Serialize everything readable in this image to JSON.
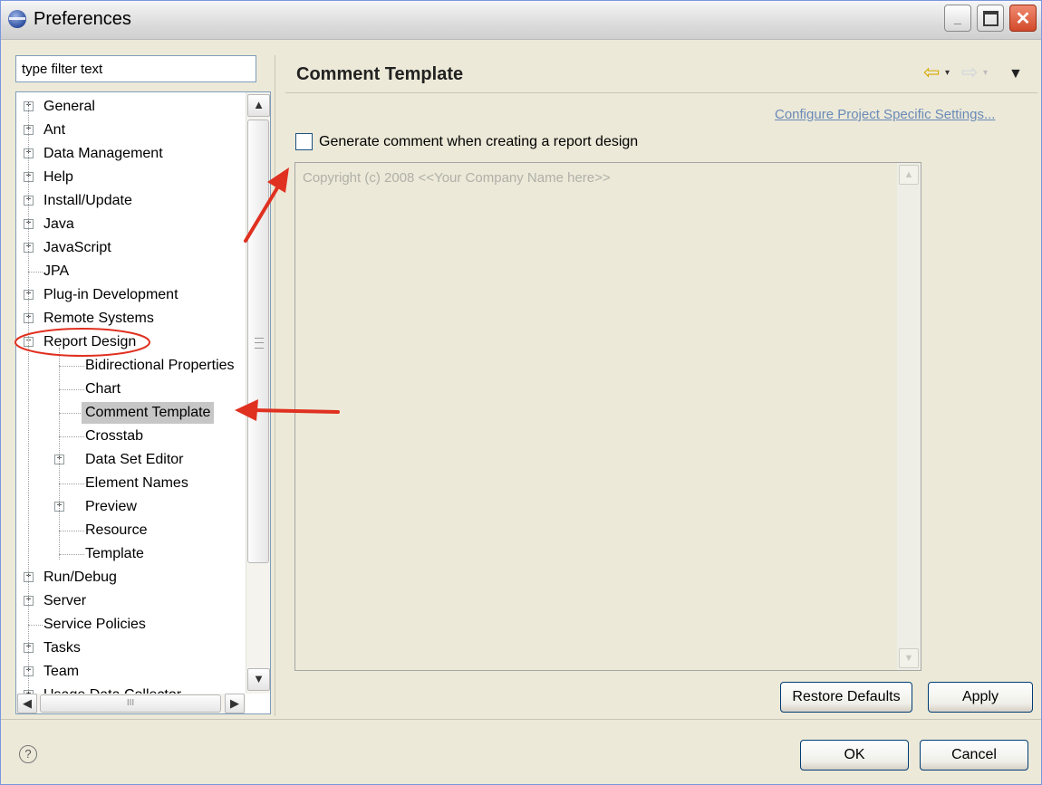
{
  "window": {
    "title": "Preferences",
    "controls": {
      "minimize": "_",
      "close": "✕"
    }
  },
  "filter": {
    "value": "type filter text"
  },
  "tree": {
    "items": [
      {
        "label": "General",
        "level": 0,
        "expander": "+"
      },
      {
        "label": "Ant",
        "level": 0,
        "expander": "+"
      },
      {
        "label": "Data Management",
        "level": 0,
        "expander": "+"
      },
      {
        "label": "Help",
        "level": 0,
        "expander": "+"
      },
      {
        "label": "Install/Update",
        "level": 0,
        "expander": "+"
      },
      {
        "label": "Java",
        "level": 0,
        "expander": "+"
      },
      {
        "label": "JavaScript",
        "level": 0,
        "expander": "+"
      },
      {
        "label": "JPA",
        "level": 0,
        "expander": ""
      },
      {
        "label": "Plug-in Development",
        "level": 0,
        "expander": "+"
      },
      {
        "label": "Remote Systems",
        "level": 0,
        "expander": "+"
      },
      {
        "label": "Report Design",
        "level": 0,
        "expander": "−"
      },
      {
        "label": "Bidirectional Properties",
        "level": 1,
        "expander": ""
      },
      {
        "label": "Chart",
        "level": 1,
        "expander": ""
      },
      {
        "label": "Comment Template",
        "level": 1,
        "expander": "",
        "selected": true
      },
      {
        "label": "Crosstab",
        "level": 1,
        "expander": ""
      },
      {
        "label": "Data Set Editor",
        "level": 1,
        "expander": "+"
      },
      {
        "label": "Element Names",
        "level": 1,
        "expander": ""
      },
      {
        "label": "Preview",
        "level": 1,
        "expander": "+"
      },
      {
        "label": "Resource",
        "level": 1,
        "expander": ""
      },
      {
        "label": "Template",
        "level": 1,
        "expander": ""
      },
      {
        "label": "Run/Debug",
        "level": 0,
        "expander": "+"
      },
      {
        "label": "Server",
        "level": 0,
        "expander": "+"
      },
      {
        "label": "Service Policies",
        "level": 0,
        "expander": ""
      },
      {
        "label": "Tasks",
        "level": 0,
        "expander": "+"
      },
      {
        "label": "Team",
        "level": 0,
        "expander": "+"
      },
      {
        "label": "Usage Data Collector",
        "level": 0,
        "expander": "+"
      }
    ],
    "scroll_up": "▲",
    "scroll_down": "▼",
    "scroll_left": "◀",
    "scroll_right": "▶",
    "hthumb_grip": "III"
  },
  "page": {
    "title": "Comment Template",
    "back_icon": "⇦",
    "forward_icon": "⇨",
    "drop_icon": "▾",
    "menu_icon": "▼",
    "project_settings_link": "Configure Project Specific Settings...",
    "checkbox_label": "Generate comment when creating a report design",
    "checkbox_checked": false,
    "template_text": "Copyright (c) 2008 <<Your Company Name here>>",
    "ta_up": "▲",
    "ta_down": "▼"
  },
  "buttons": {
    "restore_defaults": "Restore Defaults",
    "apply": "Apply",
    "ok": "OK",
    "cancel": "Cancel",
    "help": "?"
  },
  "colors": {
    "annotation": "#e03020",
    "selection": "#c6c6c6",
    "link": "#6a8ab8"
  }
}
